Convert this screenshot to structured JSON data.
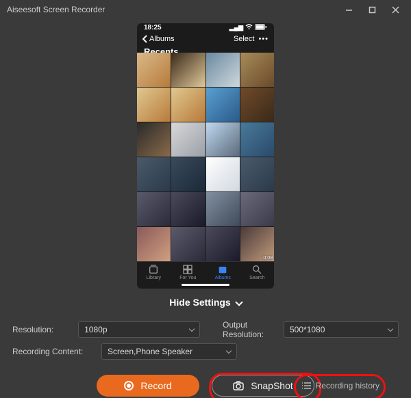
{
  "window": {
    "title": "Aiseesoft Screen Recorder"
  },
  "phone": {
    "status_time": "18:25",
    "back_label": "Albums",
    "title": "Recents",
    "select_label": "Select",
    "video_duration": "0:09",
    "tabs": [
      {
        "label": "Library"
      },
      {
        "label": "For You"
      },
      {
        "label": "Albums"
      },
      {
        "label": "Search"
      }
    ]
  },
  "toggle": {
    "hide_label": "Hide Settings"
  },
  "settings": {
    "resolution_label": "Resolution:",
    "resolution_value": "1080p",
    "output_label": "Output Resolution:",
    "output_value": "500*1080",
    "content_label": "Recording Content:",
    "content_value": "Screen,Phone Speaker"
  },
  "buttons": {
    "record": "Record",
    "snapshot": "SnapShot",
    "history": "Recording history"
  },
  "thumbs": [
    [
      "#d9b98a,#b87a3a",
      "#3a2a1a,#e0c89a",
      "#6a8aa0,#cfd8dc",
      "#a88c5a,#6a4a2a"
    ],
    [
      "#e0c890,#b87a3a",
      "#e0c890,#b87a3a",
      "#5aa0d0,#2a5a8a",
      "#704a2a,#3a2a18"
    ],
    [
      "#2a2a2a,#8a6a4a",
      "#d8d8d8,#9aa0a8",
      "#c0d8f0,#5a6a7a",
      "#4a7a9a,#2a4a6a"
    ],
    [
      "#4a5a6a,#2a3a4a",
      "#3a4a5a,#1a2a3a",
      "#ffffff,#d0d8e0",
      "#4a5a6a,#2a3a4a"
    ],
    [
      "#5a5a6a,#2a2a3a",
      "#4a4a5a,#1a1a2a",
      "#8090a0,#404a5a",
      "#6a6a7a,#3a3a4a"
    ],
    [
      "#8a5a5a,#d0a080",
      "#5a5a6a,#2a2a3a",
      "#4a4a5a,#1a1a2a",
      "#4a3a3a,#c09a7a"
    ]
  ]
}
